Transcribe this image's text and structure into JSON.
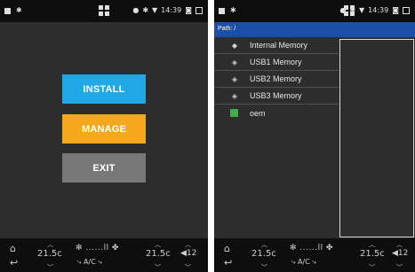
{
  "status_bar": {
    "bluetooth_glyph": "✱",
    "time": "14:39",
    "icons": [
      "location-icon",
      "bluetooth-icon",
      "wifi-icon",
      "camera-icon",
      "recents-icon"
    ]
  },
  "main_menu": {
    "install_label": "INSTALL",
    "manage_label": "MANAGE",
    "exit_label": "EXIT",
    "colors": {
      "install": "#1fa7e6",
      "manage": "#f5a81e",
      "exit": "#787878"
    }
  },
  "climate_bar": {
    "temp_left": "21.5c",
    "temp_right": "21.5c",
    "fan_level": "✻ ......ll ✤",
    "ac_label": "A/C",
    "volume": "◀12"
  },
  "file_manager": {
    "path_label": "Path: /",
    "items": [
      {
        "name": "Internal Memory",
        "icon": "drive-icon"
      },
      {
        "name": "USB1 Memory",
        "icon": "usb-icon"
      },
      {
        "name": "USB2 Memory",
        "icon": "usb-icon"
      },
      {
        "name": "USB3 Memory",
        "icon": "usb-icon"
      },
      {
        "name": "oem",
        "icon": "sd-card-icon"
      }
    ]
  }
}
